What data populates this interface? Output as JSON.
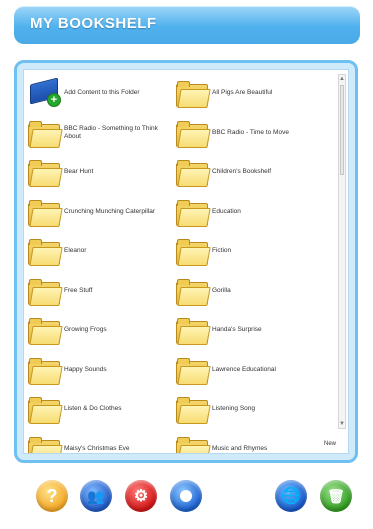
{
  "header": {
    "title": "MY BOOKSHELF"
  },
  "items": [
    {
      "label": "Add Content to this Folder",
      "icon": "add-content-book-icon"
    },
    {
      "label": "All Pigs Are Beautiful",
      "icon": "folder-icon"
    },
    {
      "label": "BBC Radio - Something to Think About",
      "icon": "folder-icon"
    },
    {
      "label": "BBC Radio - Time to Move",
      "icon": "folder-icon"
    },
    {
      "label": "Bear Hunt",
      "icon": "folder-icon"
    },
    {
      "label": "Children's Bookshelf",
      "icon": "folder-icon"
    },
    {
      "label": "Crunching Munching Caterpillar",
      "icon": "folder-icon"
    },
    {
      "label": "Education",
      "icon": "folder-icon"
    },
    {
      "label": "Eleanor",
      "icon": "folder-icon"
    },
    {
      "label": "Fiction",
      "icon": "folder-icon"
    },
    {
      "label": "Free Stuff",
      "icon": "folder-icon"
    },
    {
      "label": "Gorilla",
      "icon": "folder-icon"
    },
    {
      "label": "Growing Frogs",
      "icon": "folder-icon"
    },
    {
      "label": "Handa's Surprise",
      "icon": "folder-icon"
    },
    {
      "label": "Happy Sounds",
      "icon": "folder-icon"
    },
    {
      "label": "Lawrence Educational",
      "icon": "folder-icon"
    },
    {
      "label": "Listen & Do Clothes",
      "icon": "folder-icon"
    },
    {
      "label": "Listening Song",
      "icon": "folder-icon"
    },
    {
      "label": "Maisy's Christmas Eve",
      "icon": "folder-icon"
    },
    {
      "label": "Music and Rhymes",
      "icon": "folder-icon"
    }
  ],
  "footer": {
    "new_label": "New"
  },
  "toolbar": {
    "buttons": [
      "help-icon",
      "users-icon",
      "settings-gear-icon",
      "disc-icon",
      "globe-icon",
      "trash-icon"
    ],
    "help_glyph": "?"
  },
  "colors": {
    "header": "#4fb1ee",
    "panel_border": "#6fc0f2",
    "folder": "#f5d66a"
  }
}
